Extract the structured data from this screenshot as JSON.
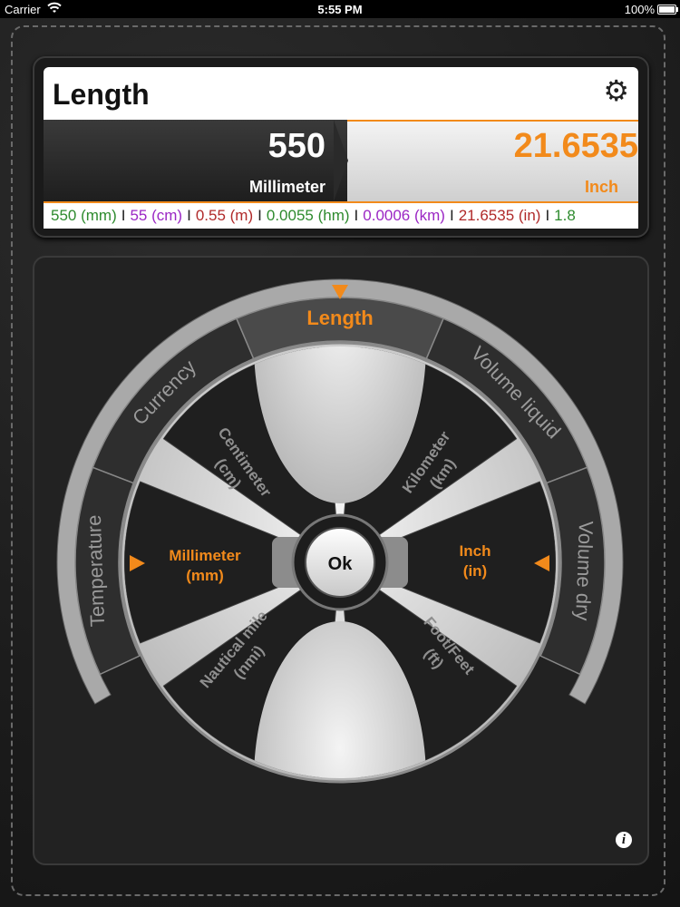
{
  "status": {
    "carrier": "Carrier",
    "time": "5:55 PM",
    "battery": "100%"
  },
  "header": {
    "title": "Length"
  },
  "from": {
    "value": "550",
    "unit": "Millimeter"
  },
  "to": {
    "value": "21.6535",
    "unit": "Inch"
  },
  "ticker": [
    {
      "text": "550 (mm)",
      "color": "#2e8b2e"
    },
    {
      "text": "55 (cm)",
      "color": "#9b27c4"
    },
    {
      "text": "0.55 (m)",
      "color": "#b02a2a"
    },
    {
      "text": "0.0055 (hm)",
      "color": "#2e8b2e"
    },
    {
      "text": "0.0006 (km)",
      "color": "#9b27c4"
    },
    {
      "text": "21.6535 (in)",
      "color": "#b02a2a"
    },
    {
      "text": "1.8",
      "color": "#2e8b2e"
    }
  ],
  "categories": [
    "Temperature",
    "Currency",
    "Length",
    "Volume liquid",
    "Volume dry"
  ],
  "selected_category": "Length",
  "units": {
    "centimeter": [
      "Centimeter",
      "(cm)"
    ],
    "kilometer": [
      "Kilometer",
      "(km)"
    ],
    "millimeter": [
      "Millimeter",
      "(mm)"
    ],
    "inch": [
      "Inch",
      "(in)"
    ],
    "nautical": [
      "Nautical mile",
      "(nmi)"
    ],
    "foot": [
      "Foot/Feet",
      "(ft)"
    ]
  },
  "ok_label": "Ok",
  "colors": {
    "accent": "#f28a1b"
  },
  "icons": {
    "settings": "gear-icon",
    "info": "info-icon"
  }
}
